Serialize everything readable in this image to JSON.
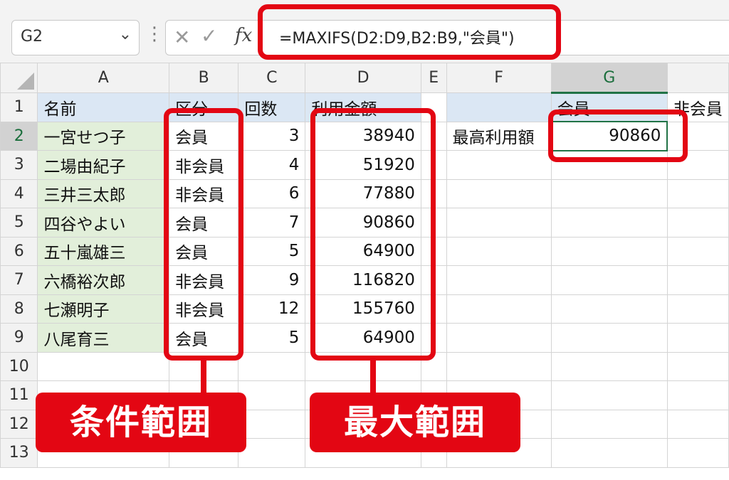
{
  "formula_bar": {
    "name_box": "G2",
    "chevron": "⌄",
    "dots": "⋮",
    "cancel": "✕",
    "enter": "✓",
    "fx": "fx",
    "formula": "=MAXIFS(D2:D9,B2:B9,\"会員\")"
  },
  "sheet": {
    "corner": "",
    "columns": [
      "A",
      "B",
      "C",
      "D",
      "E",
      "F",
      "G",
      ""
    ],
    "selected_column": "G",
    "selected_row": "2",
    "rows": [
      {
        "num": "1",
        "a": "名前",
        "b": "区分",
        "c": "回数",
        "d": "利用金額",
        "e": "",
        "f": "",
        "g": "会員",
        "h": "非会員"
      },
      {
        "num": "2",
        "a": "一宮せつ子",
        "b": "会員",
        "c": "3",
        "d": "38940",
        "e": "",
        "f": "最高利用額",
        "g": "90860",
        "h": ""
      },
      {
        "num": "3",
        "a": "二場由紀子",
        "b": "非会員",
        "c": "4",
        "d": "51920",
        "e": "",
        "f": "",
        "g": "",
        "h": ""
      },
      {
        "num": "4",
        "a": "三井三太郎",
        "b": "非会員",
        "c": "6",
        "d": "77880",
        "e": "",
        "f": "",
        "g": "",
        "h": ""
      },
      {
        "num": "5",
        "a": "四谷やよい",
        "b": "会員",
        "c": "7",
        "d": "90860",
        "e": "",
        "f": "",
        "g": "",
        "h": ""
      },
      {
        "num": "6",
        "a": "五十嵐雄三",
        "b": "会員",
        "c": "5",
        "d": "64900",
        "e": "",
        "f": "",
        "g": "",
        "h": ""
      },
      {
        "num": "7",
        "a": "六橋裕次郎",
        "b": "非会員",
        "c": "9",
        "d": "116820",
        "e": "",
        "f": "",
        "g": "",
        "h": ""
      },
      {
        "num": "8",
        "a": "七瀬明子",
        "b": "非会員",
        "c": "12",
        "d": "155760",
        "e": "",
        "f": "",
        "g": "",
        "h": ""
      },
      {
        "num": "9",
        "a": "八尾育三",
        "b": "会員",
        "c": "5",
        "d": "64900",
        "e": "",
        "f": "",
        "g": "",
        "h": ""
      },
      {
        "num": "10",
        "a": "",
        "b": "",
        "c": "",
        "d": "",
        "e": "",
        "f": "",
        "g": "",
        "h": ""
      },
      {
        "num": "11",
        "a": "",
        "b": "",
        "c": "",
        "d": "",
        "e": "",
        "f": "",
        "g": "",
        "h": ""
      },
      {
        "num": "12",
        "a": "",
        "b": "",
        "c": "",
        "d": "",
        "e": "",
        "f": "",
        "g": "",
        "h": ""
      },
      {
        "num": "13",
        "a": "",
        "b": "",
        "c": "",
        "d": "",
        "e": "",
        "f": "",
        "g": "",
        "h": ""
      }
    ]
  },
  "callouts": {
    "condition_range": "条件範囲",
    "max_range": "最大範囲"
  },
  "colors": {
    "highlight_red": "#e30613",
    "excel_green": "#217346",
    "header_fill": "#dbe7f4",
    "name_fill": "#e2efda"
  }
}
